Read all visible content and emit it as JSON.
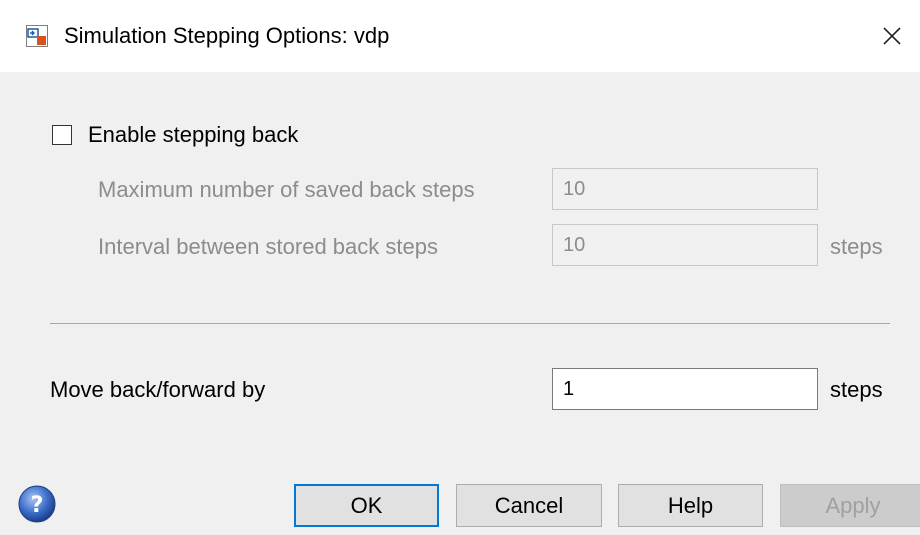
{
  "window": {
    "title": "Simulation Stepping Options: vdp",
    "close_glyph": "✕"
  },
  "stepping_back": {
    "enable_label": "Enable stepping back",
    "enabled": false,
    "max_saved_label": "Maximum number of saved back steps",
    "max_saved_value": "10",
    "interval_label": "Interval between stored back steps",
    "interval_value": "10",
    "interval_unit": "steps"
  },
  "move": {
    "label": "Move back/forward by",
    "value": "1",
    "unit": "steps"
  },
  "buttons": {
    "ok": "OK",
    "cancel": "Cancel",
    "help": "Help",
    "apply": "Apply"
  },
  "icons": {
    "app": "simulink-app-icon",
    "close": "close-icon",
    "help": "help-icon"
  },
  "colors": {
    "default_button_border": "#0078d7",
    "help_icon": "#3d6fc9"
  }
}
